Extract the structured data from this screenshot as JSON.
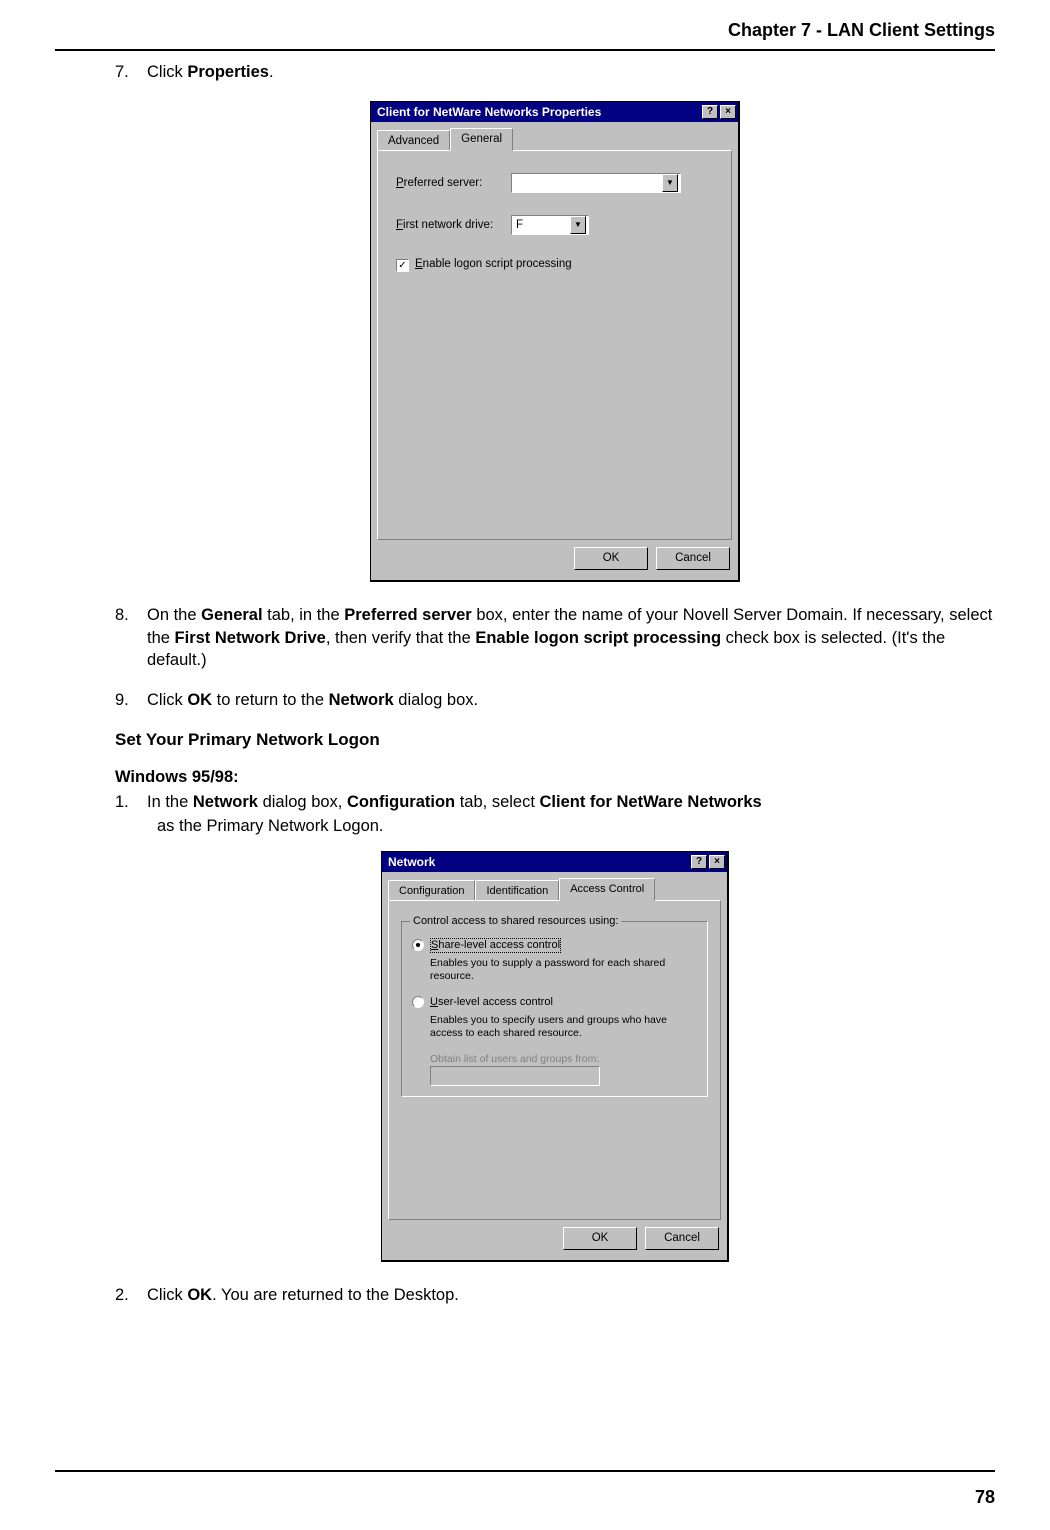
{
  "header": {
    "chapter": "Chapter 7 - LAN Client Settings"
  },
  "footer": {
    "page_num": "78"
  },
  "steps_a": {
    "s7": {
      "num": "7.",
      "pre": "Click ",
      "bold": "Properties",
      "post": "."
    },
    "s8": {
      "num": "8.",
      "t1": "On the ",
      "b1": "General",
      "t2": " tab, in the ",
      "b2": "Preferred server",
      "t3": " box, enter the name of your Novell Server Domain. If necessary, select the ",
      "b3": "First Network Drive",
      "t4": ", then verify that the ",
      "b4": "Enable logon script processing",
      "t5": " check box is selected. (It's the default.)"
    },
    "s9": {
      "num": "9.",
      "t1": "Click ",
      "b1": "OK",
      "t2": " to return to the ",
      "b2": "Network",
      "t3": " dialog box."
    }
  },
  "section": {
    "heading": "Set  Your Primary Network Logon",
    "subheading": "Windows 95/98:"
  },
  "steps_b": {
    "s1": {
      "num": "1.",
      "t1": "In the ",
      "b1": "Network",
      "t2": " dialog box, ",
      "b2": "Configuration",
      "t3": " tab, select ",
      "b3": "Client for NetWare Networks",
      "t4_indent": " as the Primary Network Logon."
    },
    "s2": {
      "num": "2.",
      "t1": "Click ",
      "b1": "OK",
      "t2": ". You are returned to the Desktop."
    }
  },
  "dialog1": {
    "title": "Client for NetWare Networks Properties",
    "help_glyph": "?",
    "close_glyph": "×",
    "tabs": {
      "advanced": "Advanced",
      "general": "General"
    },
    "labels": {
      "preferred_server": "Preferred server:",
      "first_network_drive": "First network drive:",
      "enable_logon": "Enable logon script processing"
    },
    "values": {
      "preferred_server": "",
      "first_network_drive": "F",
      "enable_checked": "✓"
    },
    "dropdown_glyph": "▼",
    "buttons": {
      "ok": "OK",
      "cancel": "Cancel"
    }
  },
  "dialog2": {
    "title": "Network",
    "help_glyph": "?",
    "close_glyph": "×",
    "tabs": {
      "configuration": "Configuration",
      "identification": "Identification",
      "access_control": "Access Control"
    },
    "group_label": "Control access to shared resources using:",
    "radio1": {
      "label": "Share-level access control",
      "desc": "Enables you to supply a password for each shared resource."
    },
    "radio2": {
      "label": "User-level access control",
      "desc": "Enables you to specify users and groups who have access to each shared resource."
    },
    "obtain_label": "Obtain list of users and groups from:",
    "buttons": {
      "ok": "OK",
      "cancel": "Cancel"
    }
  }
}
